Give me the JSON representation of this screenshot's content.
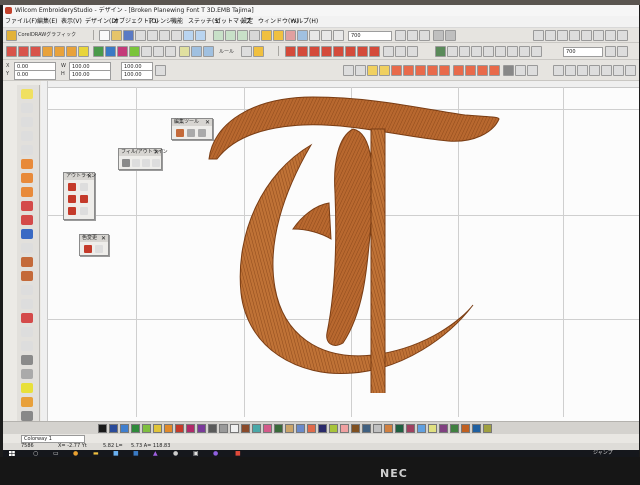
{
  "app": {
    "title": "Wilcom EmbroideryStudio - デザイン - [Broken Planewing Font T 3D.EMB  Tajima]"
  },
  "menubar": {
    "items": [
      "ファイル(F)",
      "編集(E)",
      "表示(V)",
      "デザイン(D)",
      "オブジェクト(O)",
      "アレンジ",
      "機能",
      "ステッチ(S)",
      "ビットマップ",
      "設定",
      "ウィンドウ(W)",
      "ヘルプ(H)"
    ]
  },
  "toolbar1": {
    "mode_label": "CorelDRAWグラフィック",
    "zoom_value": "700"
  },
  "toolbar2": {
    "tool_label": "ルール",
    "stitch_value": "700"
  },
  "toolbar3": {
    "x_label": "X",
    "x_value": "0.00",
    "y_label": "Y",
    "y_value": "0.00",
    "w_label": "W",
    "w_value": "100.00",
    "h_label": "H",
    "h_value": "100.00"
  },
  "floating_toolboxes": [
    {
      "title": "編集ツール"
    },
    {
      "title": "フィル/アウトライン"
    },
    {
      "title": "アウトライン"
    },
    {
      "title": "色変更"
    }
  ],
  "colorway": {
    "value": "Colorway 1"
  },
  "statusbar": {
    "stitch_count": "7586",
    "x_readout": "X= -2.77 Yt",
    "y_readout": "5.82 L=",
    "len_readout": "5.73 A= 118.83"
  },
  "taskbar": {
    "time": "ジャンプ"
  },
  "monitor": {
    "brand": "NEC"
  },
  "colors": {
    "thread": "#b8682f",
    "thread_dark": "#7a3d14",
    "thread_light": "#e3a16a"
  },
  "palette": [
    "#1a1a1a",
    "#2a4b9a",
    "#3f7fcf",
    "#2f8a3a",
    "#7fbf3f",
    "#e0c43a",
    "#e08a2a",
    "#c43a2a",
    "#b02a6a",
    "#7a3a9a",
    "#5a5a5a",
    "#9a9a9a",
    "#f0f0f0",
    "#8a4a2a",
    "#4aa8a8",
    "#d45a8a",
    "#3a6a3a",
    "#caa46a",
    "#6a8aca",
    "#e06a4a",
    "#2a2a6a",
    "#a8c43a",
    "#f0a0a0",
    "#805020",
    "#406080",
    "#c0c0c0",
    "#d08040",
    "#206040",
    "#a04060",
    "#60a0e0",
    "#e0e080",
    "#804080",
    "#408040",
    "#c06020",
    "#2060a0",
    "#a0a040"
  ]
}
